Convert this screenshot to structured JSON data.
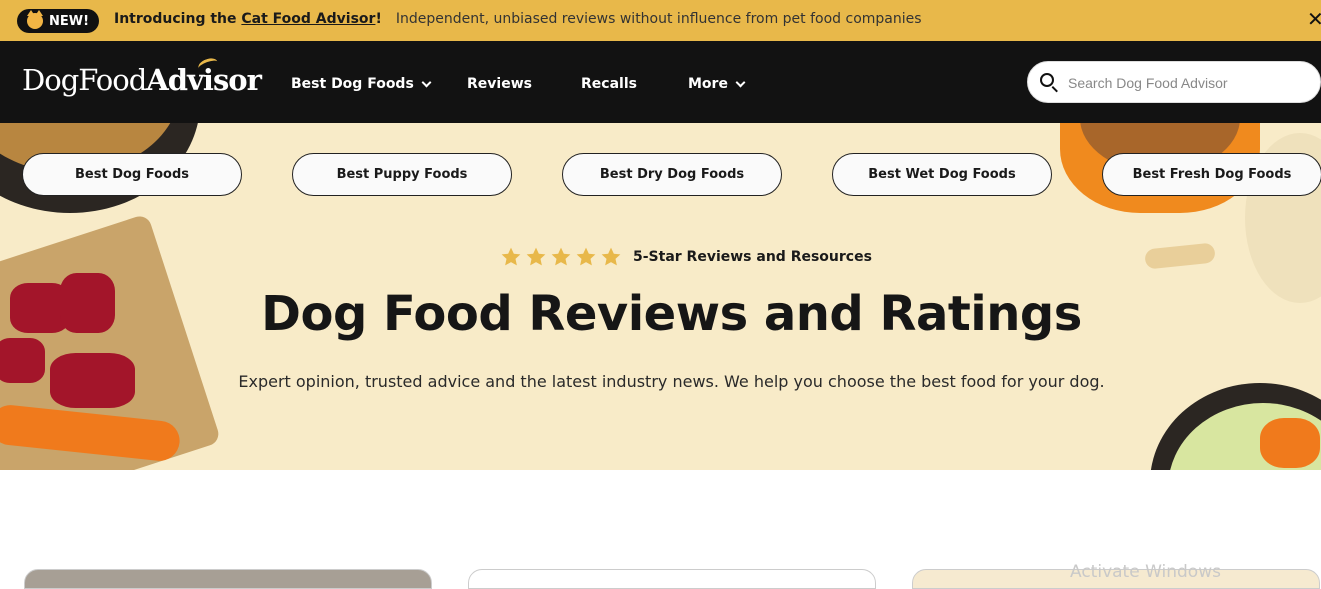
{
  "announcement": {
    "badge": "NEW!",
    "intro": "Introducing the ",
    "link": "Cat Food Advisor",
    "bang": "!",
    "subtext": "Independent, unbiased reviews without influence from pet food companies",
    "close": "✕"
  },
  "nav": {
    "logo_main": "DogFood",
    "logo_bold": "Advisor",
    "items": [
      {
        "label": "Best Dog Foods",
        "dropdown": true
      },
      {
        "label": "Reviews",
        "dropdown": false
      },
      {
        "label": "Recalls",
        "dropdown": false
      },
      {
        "label": "More",
        "dropdown": true
      }
    ],
    "search_placeholder": "Search Dog Food Advisor"
  },
  "hero": {
    "pills": [
      "Best Dog Foods",
      "Best Puppy Foods",
      "Best Dry Dog Foods",
      "Best Wet Dog Foods",
      "Best Fresh Dog Foods"
    ],
    "rating_stars": 5,
    "stars_label": "5-Star Reviews and Resources",
    "title": "Dog Food Reviews and Ratings",
    "subtitle": "Expert opinion, trusted advice and the latest industry news. We help you choose the best food for your dog."
  },
  "watermark": "Activate Windows",
  "colors": {
    "accent": "#e8b84a",
    "nav_bg": "#121212",
    "hero_bg": "#f8ebc8",
    "star": "#e8b84a"
  }
}
